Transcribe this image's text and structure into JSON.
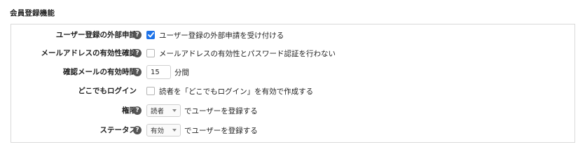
{
  "section": {
    "title": "会員登録機能"
  },
  "rows": [
    {
      "label": "ユーザー登録の外部申請",
      "control_type": "checkbox",
      "checked": true,
      "text": "ユーザー登録の外部申請を受け付ける"
    },
    {
      "label": "メールアドレスの有効性確認",
      "control_type": "checkbox",
      "checked": false,
      "text": "メールアドレスの有効性とパスワード認証を行わない"
    },
    {
      "label": "確認メールの有効時間",
      "control_type": "number",
      "value": "15",
      "unit": "分間"
    },
    {
      "label": "どこでもログイン",
      "control_type": "checkbox",
      "checked": false,
      "text": "読者を「どこでもログイン」を有効で作成する"
    },
    {
      "label": "権限",
      "control_type": "select",
      "selected": "読者",
      "text": "でユーザーを登録する"
    },
    {
      "label": "ステータス",
      "control_type": "select",
      "selected": "有効",
      "text": "でユーザーを登録する"
    }
  ],
  "help_icon_glyph": "?",
  "icons": {
    "help": "help-icon",
    "check": "checkmark-icon",
    "caret": "chevron-down-icon"
  },
  "colors": {
    "accent": "#1e73e8",
    "help_icon_bg": "#555555",
    "border": "#d9d9d9"
  }
}
